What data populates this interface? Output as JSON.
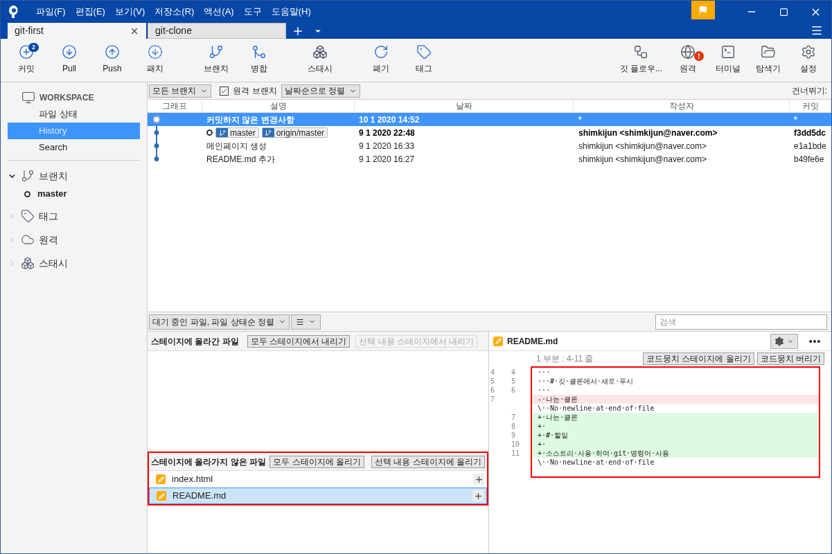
{
  "menu": [
    "파일(F)",
    "편집(E)",
    "보기(V)",
    "저장소(R)",
    "액션(A)",
    "도구",
    "도움말(H)"
  ],
  "tabs": [
    {
      "label": "git-first",
      "selected": true
    },
    {
      "label": "git-clone",
      "selected": false
    }
  ],
  "toolbar_left": [
    {
      "kind": "commit",
      "label": "커밋",
      "badge": "2"
    },
    {
      "kind": "pull",
      "label": "Pull"
    },
    {
      "kind": "push",
      "label": "Push"
    },
    {
      "kind": "fetch",
      "label": "패치"
    },
    {
      "kind": "branch",
      "label": "브랜치"
    },
    {
      "kind": "merge",
      "label": "병합"
    },
    {
      "kind": "stash",
      "label": "스태시"
    },
    {
      "kind": "discard",
      "label": "폐기"
    },
    {
      "kind": "tag",
      "label": "태그"
    }
  ],
  "toolbar_right": [
    {
      "kind": "flow",
      "label": "깃 플로우..."
    },
    {
      "kind": "remote",
      "label": "원격",
      "alert": "!"
    },
    {
      "kind": "terminal",
      "label": "터미널"
    },
    {
      "kind": "explorer",
      "label": "탐색기"
    },
    {
      "kind": "settings",
      "label": "설정"
    }
  ],
  "sidebar": {
    "workspace": "WORKSPACE",
    "items": [
      {
        "label": "파일 상태",
        "selected": false
      },
      {
        "label": "History",
        "selected": true
      },
      {
        "label": "Search",
        "selected": false
      }
    ],
    "sections": [
      {
        "kind": "branch",
        "label": "브랜치",
        "expanded": true,
        "children": [
          {
            "label": "master"
          }
        ]
      },
      {
        "kind": "tag",
        "label": "태그",
        "expanded": false
      },
      {
        "kind": "remote",
        "label": "원격",
        "expanded": false
      },
      {
        "kind": "stash",
        "label": "스태시",
        "expanded": false
      }
    ]
  },
  "history_toolbar": {
    "branch_filter": "모든 브랜치",
    "remote_branches": {
      "label": "원격 브랜치",
      "checked": true
    },
    "sort": "날짜순으로 정렬",
    "jump": "건너뛰기:"
  },
  "commits": {
    "columns": [
      "그래프",
      "설명",
      "날짜",
      "작성자",
      "커밋"
    ],
    "rows": [
      {
        "kind": "uncommitted",
        "description": "커밋하지 않은 변경사항",
        "date": "10 1 2020 14:52",
        "author": "*",
        "commit": "*",
        "selected": true,
        "bold": true
      },
      {
        "kind": "commit",
        "head": true,
        "refs": [
          "master",
          "origin/master"
        ],
        "date": "9 1 2020 22:48",
        "author": "shimkijun <shimkijun@naver.com>",
        "commit": "f3dd5dc",
        "selected": false,
        "bold": true
      },
      {
        "kind": "commit",
        "description": "메인페이지 생성",
        "date": "9 1 2020 16:33",
        "author": "shimkijun <shimkijun@naver.com>",
        "commit": "e1a1bde",
        "selected": false,
        "bold": false
      },
      {
        "kind": "commit",
        "description": "README.md 추가",
        "date": "9 1 2020 16:27",
        "author": "shimkijun <shimkijun@naver.com>",
        "commit": "b49fe6e",
        "selected": false,
        "bold": false
      }
    ]
  },
  "file_filter": "대기 중인 파일, 파일 상태순 정렬",
  "search": {
    "placeholder": "검색"
  },
  "staged": {
    "title": "스테이지에 올라간 파일",
    "buttons": [
      {
        "label": "모두 스테이지에서 내리기",
        "disabled": false
      },
      {
        "label": "선택 내용 스테이지에서 내리기",
        "disabled": true
      }
    ]
  },
  "unstaged": {
    "title": "스테이지에 올라가지 않은 파일",
    "highlighted": true,
    "buttons": [
      {
        "label": "모두 스테이지에 올리기",
        "disabled": false
      },
      {
        "label": "선택 내용 스테이지에 올리기",
        "disabled": false
      }
    ],
    "files": [
      {
        "name": "index.html",
        "selected": false
      },
      {
        "name": "README.md",
        "selected": true
      }
    ]
  },
  "diff": {
    "file": "README.md",
    "hunk_header": "1 부분 : 4-11 줄",
    "buttons": [
      "코드뭉치 스테이지에 올리기",
      "코드뭉치 버리기"
    ],
    "highlighted": true,
    "lines": [
      {
        "old": "4",
        "new": "4",
        "kind": "context",
        "text": "···"
      },
      {
        "old": "5",
        "new": "5",
        "kind": "context",
        "text": "···#·깃·클론에서·새로·푸시"
      },
      {
        "old": "6",
        "new": "6",
        "kind": "context",
        "text": "···"
      },
      {
        "old": "7",
        "kind": "removed",
        "text": "-·나는·클론"
      },
      {
        "kind": "context",
        "text": "\\··No·newline·at·end·of·file"
      },
      {
        "new": "7",
        "kind": "added",
        "text": "+·나는·클론"
      },
      {
        "new": "8",
        "kind": "added",
        "text": "+·"
      },
      {
        "new": "9",
        "kind": "added",
        "text": "+·#·할일"
      },
      {
        "new": "10",
        "kind": "added",
        "text": "+·"
      },
      {
        "new": "11",
        "kind": "added",
        "text": "+·소스트리·사용·하여·git·명령어·사용"
      },
      {
        "kind": "context",
        "text": "\\··No·newline·at·end·of·file"
      }
    ]
  }
}
